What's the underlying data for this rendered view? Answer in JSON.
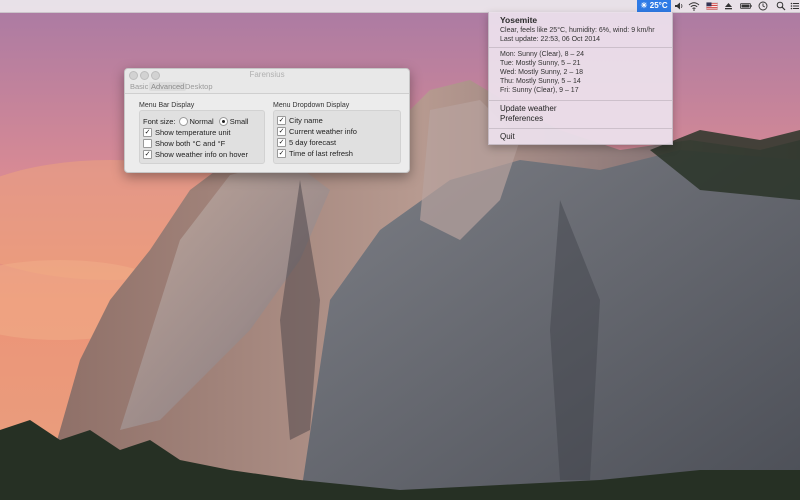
{
  "menubar": {
    "weather_temp": "25°C"
  },
  "dropdown": {
    "city": "Yosemite",
    "current": "Clear, feels like 25°C, humidity: 6%, wind: 9 km/hr",
    "last_update": "Last update: 22:53, 06 Oct 2014",
    "forecast": [
      "Mon: Sunny (Clear), 8 – 24",
      "Tue: Mostly Sunny, 5 – 21",
      "Wed: Mostly Sunny, 2 – 18",
      "Thu: Mostly Sunny, 5 – 14",
      "Fri: Sunny (Clear), 9 – 17"
    ],
    "menu": {
      "update": "Update weather",
      "preferences": "Preferences",
      "quit": "Quit"
    }
  },
  "window": {
    "title": "Farensius",
    "tabs": [
      "Basic",
      "Advanced",
      "Desktop"
    ],
    "active_tab": "Advanced",
    "menubar_display": {
      "label": "Menu Bar Display",
      "font_size_label": "Font size:",
      "font_options": [
        "Normal",
        "Small"
      ],
      "font_selected": "Small",
      "checkboxes": [
        {
          "label": "Show temperature unit",
          "checked": true
        },
        {
          "label": "Show both °C and °F",
          "checked": false
        },
        {
          "label": "Show weather info on hover",
          "checked": true
        }
      ]
    },
    "dropdown_display": {
      "label": "Menu Dropdown Display",
      "checkboxes": [
        {
          "label": "City name",
          "checked": true
        },
        {
          "label": "Current weather info",
          "checked": true
        },
        {
          "label": "5 day forecast",
          "checked": true
        },
        {
          "label": "Time of last refresh",
          "checked": true
        }
      ]
    }
  },
  "colors": {
    "accent": "#2f7be6",
    "sky_top": "#b77fa0",
    "sky_mid": "#e39a88",
    "sky_low": "#ef9e6f"
  }
}
